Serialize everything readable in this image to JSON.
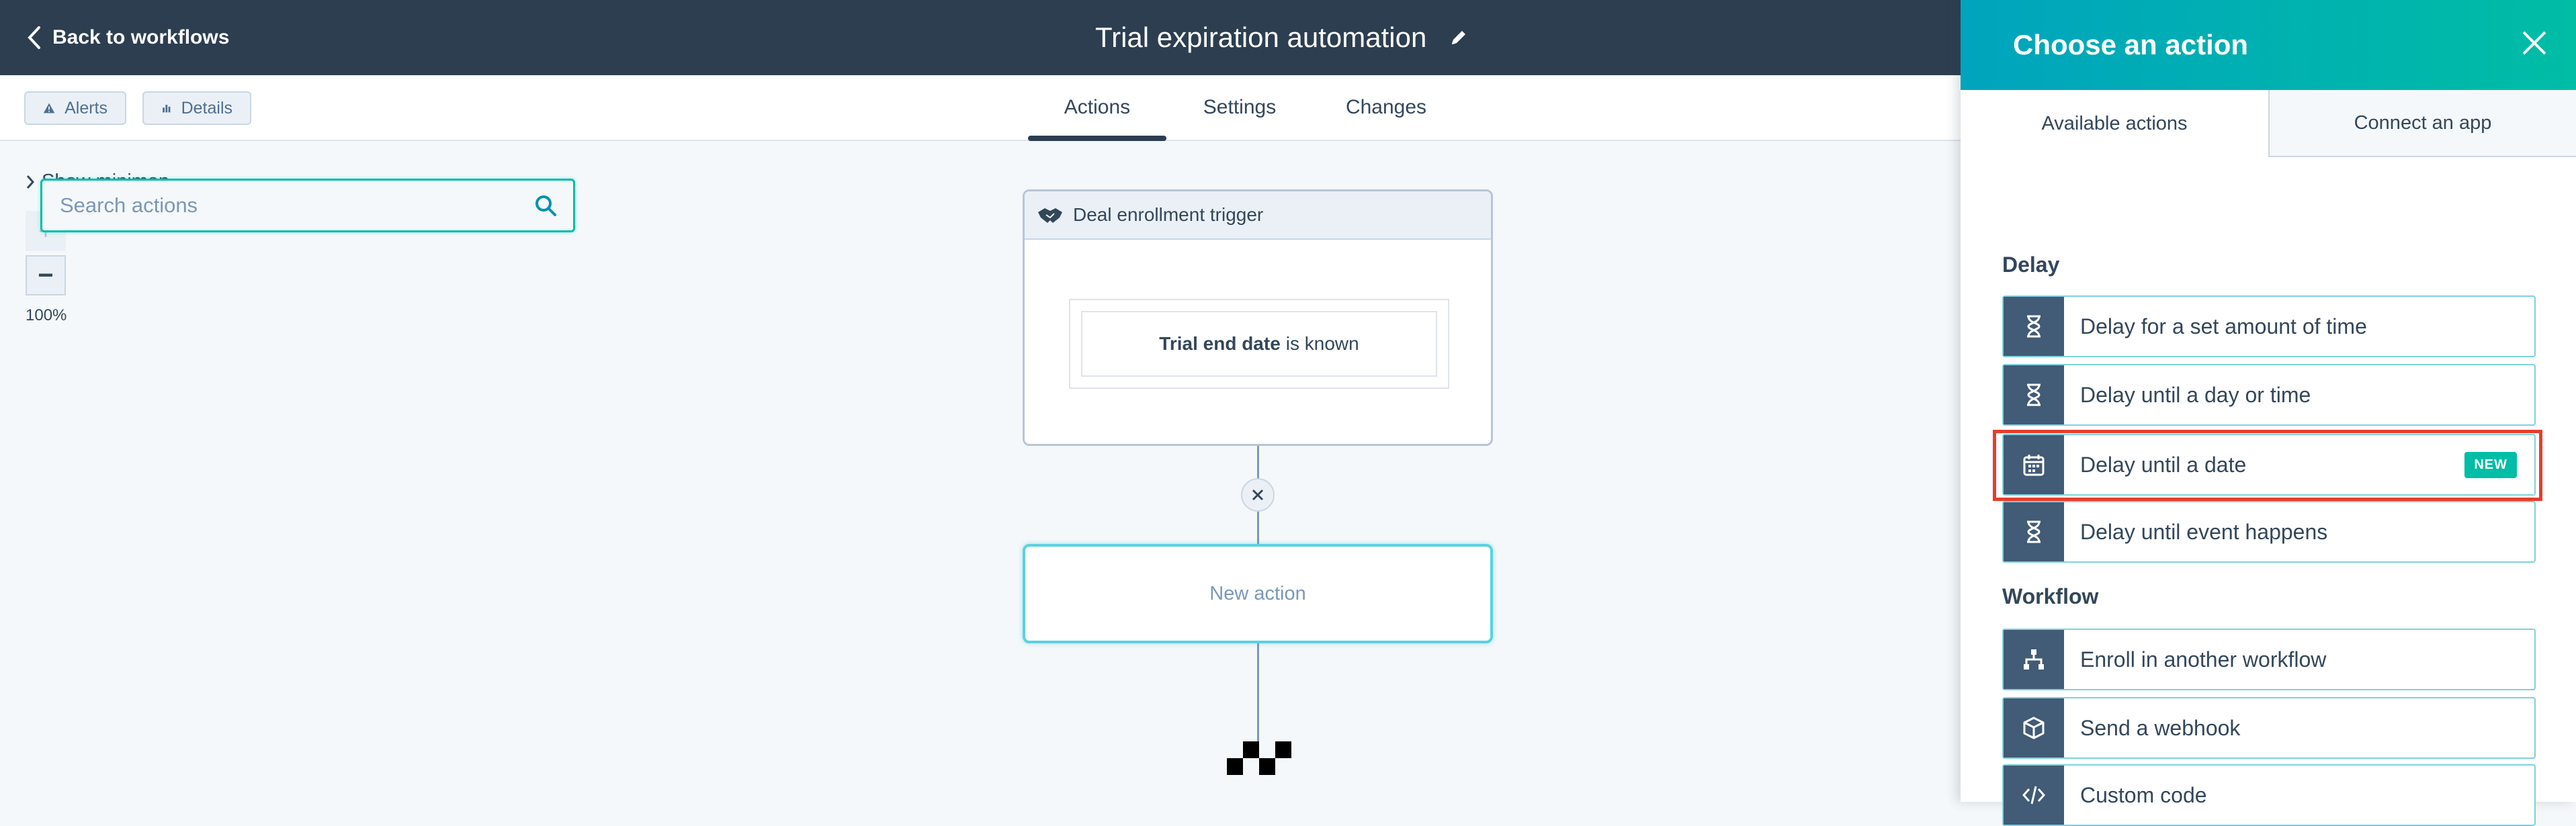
{
  "header": {
    "back_label": "Back to workflows",
    "workflow_title": "Trial expiration automation"
  },
  "subbar": {
    "alerts_label": "Alerts",
    "details_label": "Details",
    "tabs": [
      {
        "label": "Actions",
        "active": true
      },
      {
        "label": "Settings",
        "active": false
      },
      {
        "label": "Changes",
        "active": false
      }
    ]
  },
  "canvas": {
    "minimap_label": "Show minimap",
    "zoom_in": "+",
    "zoom_out": "−",
    "zoom_level": "100%",
    "trigger": {
      "title": "Deal enrollment trigger",
      "criteria_property": "Trial end date",
      "criteria_condition": "is known"
    },
    "new_action_label": "New action"
  },
  "panel": {
    "title": "Choose an action",
    "tabs": [
      "Available actions",
      "Connect an app"
    ],
    "search_placeholder": "Search actions",
    "sections": {
      "delay": {
        "label": "Delay",
        "items": [
          {
            "label": "Delay for a set amount of time",
            "icon": "hourglass-icon"
          },
          {
            "label": "Delay until a day or time",
            "icon": "hourglass-icon"
          },
          {
            "label": "Delay until a date",
            "icon": "calendar-icon",
            "badge": "NEW"
          },
          {
            "label": "Delay until event happens",
            "icon": "hourglass-icon"
          }
        ]
      },
      "workflow": {
        "label": "Workflow",
        "items": [
          {
            "label": "Enroll in another workflow",
            "icon": "sitemap-icon"
          },
          {
            "label": "Send a webhook",
            "icon": "cube-icon"
          },
          {
            "label": "Custom code",
            "icon": "code-icon"
          }
        ]
      }
    }
  },
  "colors": {
    "header_bg": "#2d3e50",
    "accent_teal": "#00bda5",
    "highlight_red": "#e53e2d",
    "icon_bg": "#425b76"
  }
}
